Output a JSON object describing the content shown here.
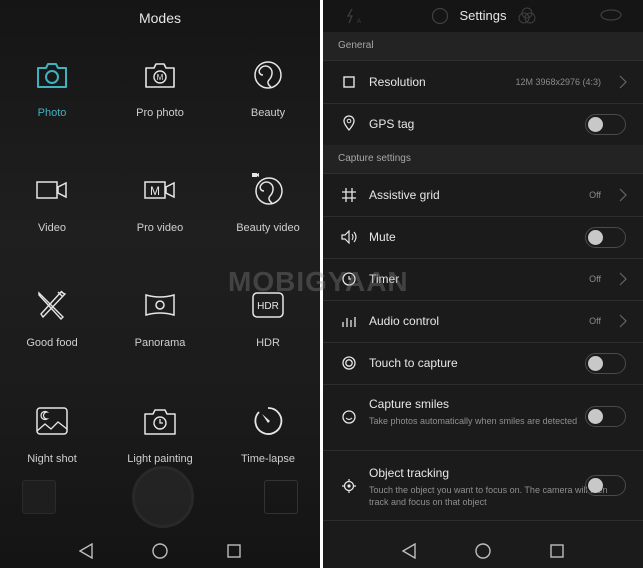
{
  "left_panel": {
    "title": "Modes",
    "modes": [
      {
        "label": "Photo",
        "icon": "camera-icon",
        "active": true
      },
      {
        "label": "Pro photo",
        "icon": "pro-camera-icon",
        "active": false
      },
      {
        "label": "Beauty",
        "icon": "beauty-face-icon",
        "active": false
      },
      {
        "label": "Video",
        "icon": "video-camera-icon",
        "active": false
      },
      {
        "label": "Pro video",
        "icon": "pro-video-icon",
        "active": false
      },
      {
        "label": "Beauty video",
        "icon": "beauty-video-icon",
        "active": false
      },
      {
        "label": "Good food",
        "icon": "fork-knife-icon",
        "active": false
      },
      {
        "label": "Panorama",
        "icon": "panorama-icon",
        "active": false
      },
      {
        "label": "HDR",
        "icon": "hdr-icon",
        "active": false
      },
      {
        "label": "Night shot",
        "icon": "night-shot-icon",
        "active": false
      },
      {
        "label": "Light painting",
        "icon": "light-painting-icon",
        "active": false
      },
      {
        "label": "Time-lapse",
        "icon": "time-lapse-icon",
        "active": false
      }
    ],
    "hdr_icon_text": "HDR",
    "pro_icon_text": "M"
  },
  "right_panel": {
    "title": "Settings",
    "sections": [
      {
        "label": "General"
      },
      {
        "label": "Capture settings"
      }
    ],
    "rows": [
      {
        "label": "Resolution",
        "icon": "resolution-square-icon",
        "value": "12M 3968x2976 (4:3)",
        "control": "chevron"
      },
      {
        "label": "GPS tag",
        "icon": "location-pin-icon",
        "control": "toggle",
        "on": false
      },
      {
        "label": "Assistive grid",
        "icon": "grid-icon",
        "value": "Off",
        "control": "chevron"
      },
      {
        "label": "Mute",
        "icon": "speaker-icon",
        "control": "toggle",
        "on": false
      },
      {
        "label": "Timer",
        "icon": "timer-clock-icon",
        "value": "Off",
        "control": "chevron"
      },
      {
        "label": "Audio control",
        "icon": "audio-bars-icon",
        "value": "Off",
        "control": "chevron"
      },
      {
        "label": "Touch to capture",
        "icon": "touch-capture-icon",
        "control": "toggle",
        "on": false
      },
      {
        "label": "Capture smiles",
        "icon": "smile-icon",
        "subtitle": "Take photos automatically when smiles are detected",
        "control": "toggle",
        "on": false
      },
      {
        "label": "Object tracking",
        "icon": "target-icon",
        "subtitle": "Touch the object you want to focus on. The camera will then track and focus on that object",
        "control": "toggle",
        "on": false
      }
    ]
  },
  "watermark": "MOBIGYAAN",
  "colors": {
    "accent": "#3fb2bf",
    "background": "#1b1b1b",
    "text": "#e8e8e8"
  }
}
